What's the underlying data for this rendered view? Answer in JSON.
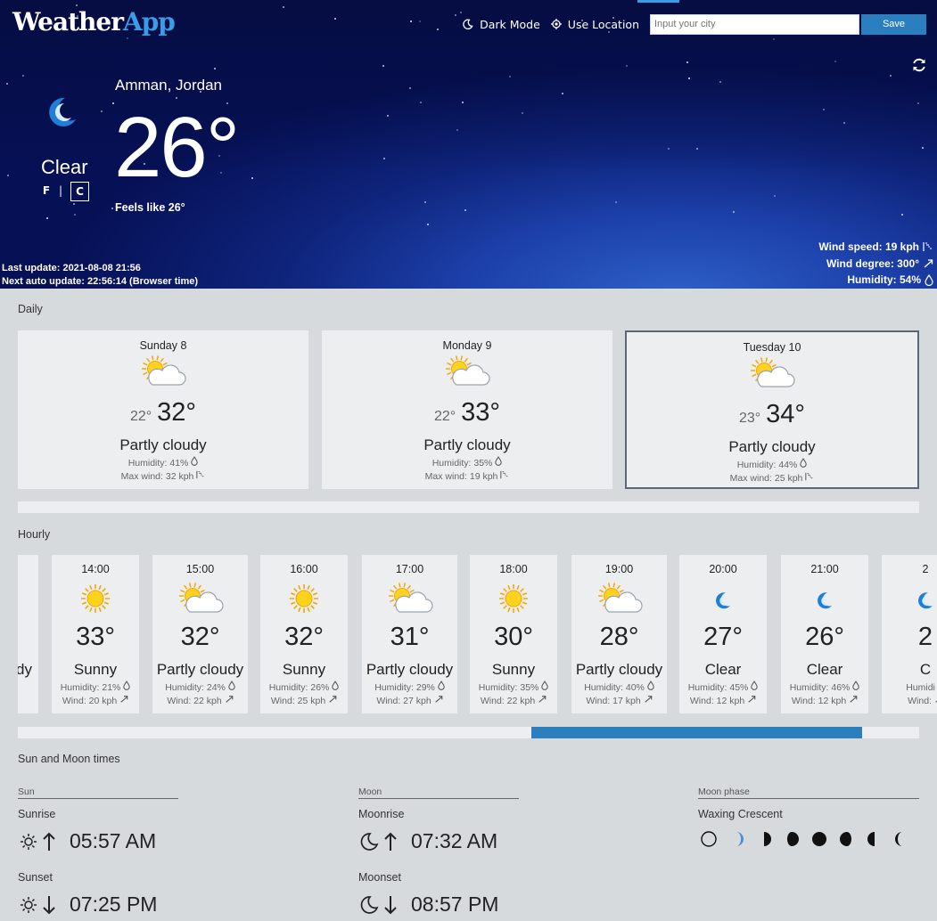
{
  "app": {
    "logo_part1": "Weather",
    "logo_part2": "App"
  },
  "topbar": {
    "dark_mode": "Dark Mode",
    "use_location": "Use Location",
    "city_placeholder": "Input your city",
    "save_label": "Save"
  },
  "current": {
    "location": "Amman, Jordan",
    "temp": "26°",
    "condition": "Clear",
    "feels_like": "Feels like 26°",
    "unit_f": "F",
    "unit_sep": "|",
    "unit_c": "C",
    "last_update": "Last update: 2021-08-08 21:56",
    "next_update": "Next auto update: 22:56:14 (Browser time)",
    "wind_speed": "Wind speed: 19 kph",
    "wind_degree": "Wind degree: 300°",
    "humidity": "Humidity: 54%"
  },
  "daily": {
    "title": "Daily",
    "days": [
      {
        "day": "Sunday 8",
        "lo": "22°",
        "hi": "32°",
        "desc": "Partly cloudy",
        "humidity": "Humidity: 41%",
        "wind": "Max wind: 32 kph",
        "icon": "partly-cloudy"
      },
      {
        "day": "Monday 9",
        "lo": "22°",
        "hi": "33°",
        "desc": "Partly cloudy",
        "humidity": "Humidity: 35%",
        "wind": "Max wind: 19 kph",
        "icon": "partly-cloudy"
      },
      {
        "day": "Tuesday 10",
        "lo": "23°",
        "hi": "34°",
        "desc": "Partly cloudy",
        "humidity": "Humidity: 44%",
        "wind": "Max wind: 25 kph",
        "icon": "partly-cloudy",
        "selected": true
      }
    ]
  },
  "hourly": {
    "title": "Hourly",
    "scroll_position": 0.57,
    "hours": [
      {
        "time": "",
        "temp": "",
        "desc": "dy",
        "humidity": "",
        "wind": "",
        "icon": "none"
      },
      {
        "time": "14:00",
        "temp": "33°",
        "desc": "Sunny",
        "humidity": "Humidity: 21%",
        "wind": "Wind: 20 kph",
        "icon": "sun"
      },
      {
        "time": "15:00",
        "temp": "32°",
        "desc": "Partly cloudy",
        "humidity": "Humidity: 24%",
        "wind": "Wind: 22 kph",
        "icon": "partly-cloudy"
      },
      {
        "time": "16:00",
        "temp": "32°",
        "desc": "Sunny",
        "humidity": "Humidity: 26%",
        "wind": "Wind: 25 kph",
        "icon": "sun"
      },
      {
        "time": "17:00",
        "temp": "31°",
        "desc": "Partly cloudy",
        "humidity": "Humidity: 29%",
        "wind": "Wind: 27 kph",
        "icon": "partly-cloudy"
      },
      {
        "time": "18:00",
        "temp": "30°",
        "desc": "Sunny",
        "humidity": "Humidity: 35%",
        "wind": "Wind: 22 kph",
        "icon": "sun"
      },
      {
        "time": "19:00",
        "temp": "28°",
        "desc": "Partly cloudy",
        "humidity": "Humidity: 40%",
        "wind": "Wind: 17 kph",
        "icon": "partly-cloudy"
      },
      {
        "time": "20:00",
        "temp": "27°",
        "desc": "Clear",
        "humidity": "Humidity: 45%",
        "wind": "Wind: 12 kph",
        "icon": "moon"
      },
      {
        "time": "21:00",
        "temp": "26°",
        "desc": "Clear",
        "humidity": "Humidity: 46%",
        "wind": "Wind: 12 kph",
        "icon": "moon"
      },
      {
        "time": "2",
        "temp": "2",
        "desc": "C",
        "humidity": "Humidi",
        "wind": "Wind:",
        "icon": "moon"
      }
    ]
  },
  "sunmoon": {
    "title": "Sun and Moon times",
    "sun_head": "Sun",
    "moon_head": "Moon",
    "phase_head": "Moon phase",
    "sunrise_label": "Sunrise",
    "sunrise": "05:57 AM",
    "sunset_label": "Sunset",
    "sunset": "07:25 PM",
    "moonrise_label": "Moonrise",
    "moonrise": "07:32 AM",
    "moonset_label": "Moonset",
    "moonset": "08:57 PM",
    "phase_name": "Waxing Crescent",
    "phases": [
      "new-moon",
      "waxing-crescent",
      "first-quarter",
      "waxing-gibbous",
      "full-moon",
      "waning-gibbous",
      "last-quarter",
      "waning-crescent"
    ],
    "active_phase": 1
  },
  "colors": {
    "accent": "#2b7fbe",
    "moon_blue": "#1e7fd8",
    "card": "#eceef0",
    "bg": "#d6dadd"
  }
}
